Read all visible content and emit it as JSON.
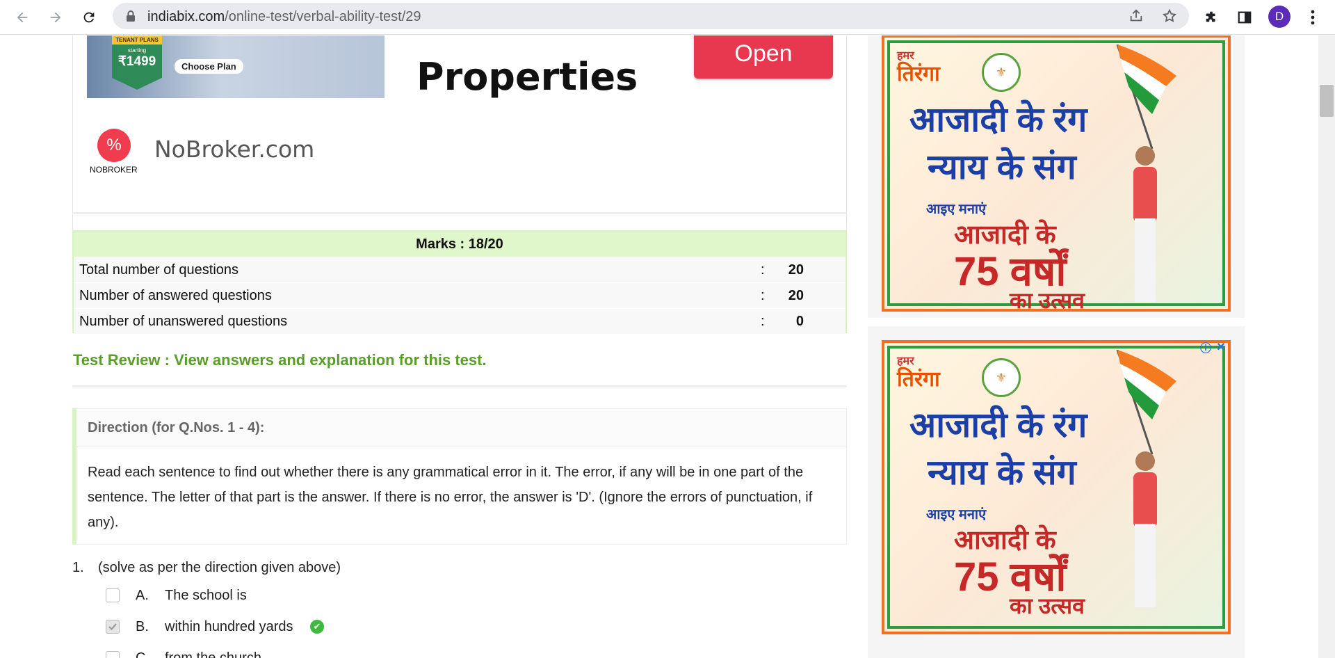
{
  "browser": {
    "url_domain": "indiabix.com",
    "url_path": "/online-test/verbal-ability-test/29",
    "avatar_letter": "D"
  },
  "ad_top": {
    "tenant_plans": "TENANT PLANS",
    "starting": "starting",
    "price": "₹1499",
    "choose_plan": "Choose Plan",
    "headline": "Properties",
    "open_label": "Open",
    "logo_text": "NOBROKER",
    "domain": "NoBroker.com"
  },
  "marks": {
    "header": "Marks : 18/20",
    "rows": [
      {
        "label": "Total number of questions",
        "colon": ":",
        "value": "20"
      },
      {
        "label": "Number of answered questions",
        "colon": ":",
        "value": "20"
      },
      {
        "label": "Number of unanswered questions",
        "colon": ":",
        "value": "0"
      }
    ]
  },
  "review_link": "Test Review : View answers and explanation for this test.",
  "direction": {
    "title": "Direction (for Q.Nos. 1 - 4):",
    "text": "Read each sentence to find out whether there is any grammatical error in it. The error, if any will be in one part of the sentence. The letter of that part is the answer. If there is no error, the answer is 'D'. (Ignore the errors of punctuation, if any)."
  },
  "question": {
    "number": "1.",
    "text": "(solve as per the direction given above)",
    "options": [
      {
        "letter": "A.",
        "text": "The school is"
      },
      {
        "letter": "B.",
        "text": "within hundred yards"
      },
      {
        "letter": "C.",
        "text": "from the church"
      }
    ]
  },
  "side_ads": {
    "small_hindi": "हमर",
    "tiranga": "तिरंगा",
    "line1": "आजादी के रंग",
    "line2": "न्याय के संग",
    "line3": "आइए मनाएं",
    "line4": "आजादी के",
    "line5": "75 वर्षों",
    "line6": "का उत्सव"
  },
  "colors": {
    "accent_green": "#5a9e2a",
    "marks_bg": "#dff7ca",
    "open_btn": "#e8384f",
    "avatar": "#5c2bb8"
  }
}
